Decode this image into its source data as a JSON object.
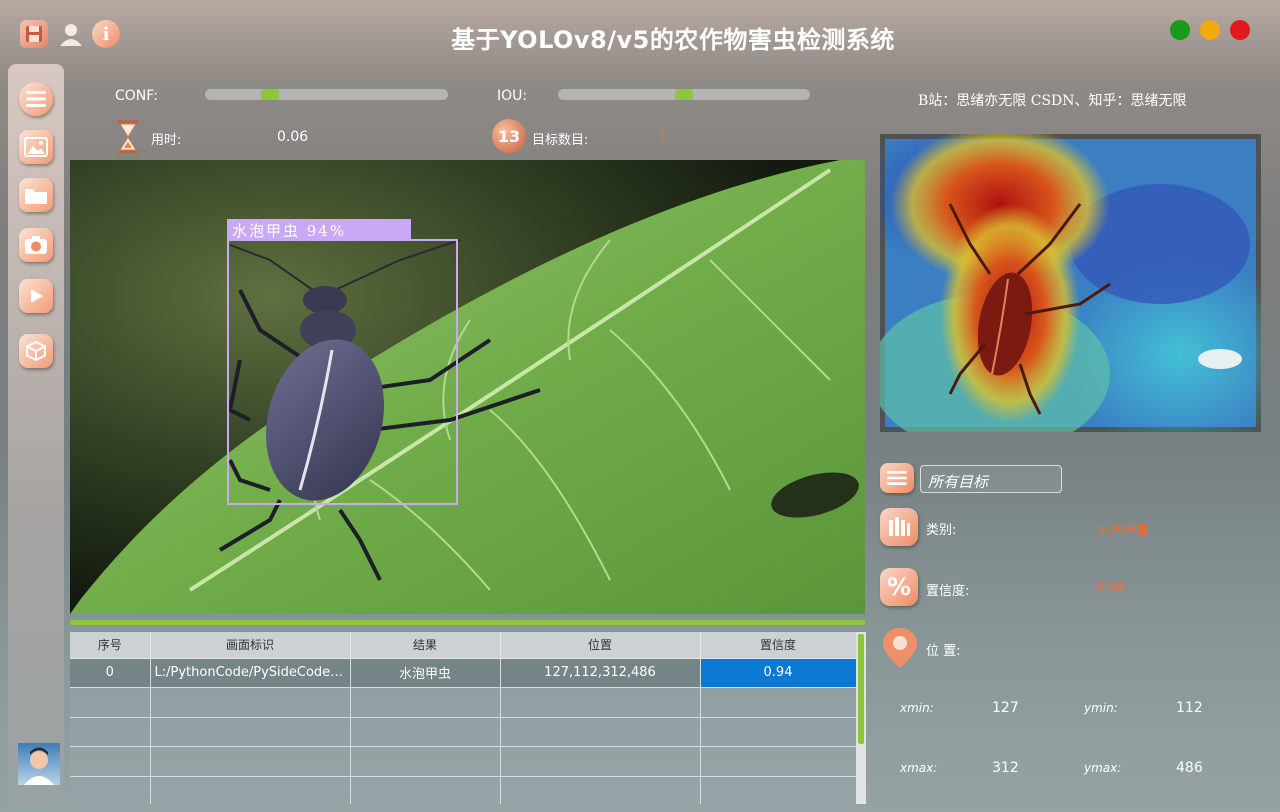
{
  "window": {
    "title": "基于YOLOv8/v5的农作物害虫检测系统",
    "icons": [
      "save-icon",
      "user-icon",
      "info-icon"
    ],
    "controls": [
      {
        "name": "maximize-button",
        "color": "#1a9a1a"
      },
      {
        "name": "minimize-button",
        "color": "#f4a90c"
      },
      {
        "name": "close-button",
        "color": "#e01a1a"
      }
    ]
  },
  "sidebar": {
    "items": [
      "menu-icon",
      "image-icon",
      "folder-icon",
      "camera-icon",
      "video-icon",
      "model-icon"
    ]
  },
  "controls": {
    "conf_label": "CONF:",
    "conf_value": 0.25,
    "iou_label": "IOU:",
    "iou_value": 0.5,
    "time_label": "用时:",
    "time_value": "0.06",
    "count_label": "目标数目:",
    "count_value": "1"
  },
  "credits": "B站：思绪亦无限  CSDN、知乎：思绪无限",
  "detection_overlay": {
    "label": "水泡甲虫  94%",
    "box_color": "#c9a9f5"
  },
  "table": {
    "headers": [
      "序号",
      "画面标识",
      "结果",
      "位置",
      "置信度"
    ],
    "rows": [
      [
        "0",
        "L:/PythonCode/PySideCode/...",
        "水泡甲虫",
        "127,112,312,486",
        "0.94"
      ],
      [
        "",
        "",
        "",
        "",
        ""
      ],
      [
        "",
        "",
        "",
        "",
        ""
      ],
      [
        "",
        "",
        "",
        "",
        ""
      ],
      [
        "",
        "",
        "",
        "",
        ""
      ]
    ]
  },
  "details": {
    "filter_value": "所有目标",
    "class_label": "类别:",
    "class_value": "水泡甲虫",
    "conf_label": "置信度:",
    "conf_value": "0.94",
    "pos_label": "位 置:",
    "xmin_label": "xmin:",
    "xmin_value": "127",
    "ymin_label": "ymin:",
    "ymin_value": "112",
    "xmax_label": "xmax:",
    "xmax_value": "312",
    "ymax_label": "ymax:",
    "ymax_value": "486"
  },
  "colors": {
    "accent": "#8cc63e",
    "highlight": "#ff6a2a",
    "selected": "#0b78d4"
  }
}
